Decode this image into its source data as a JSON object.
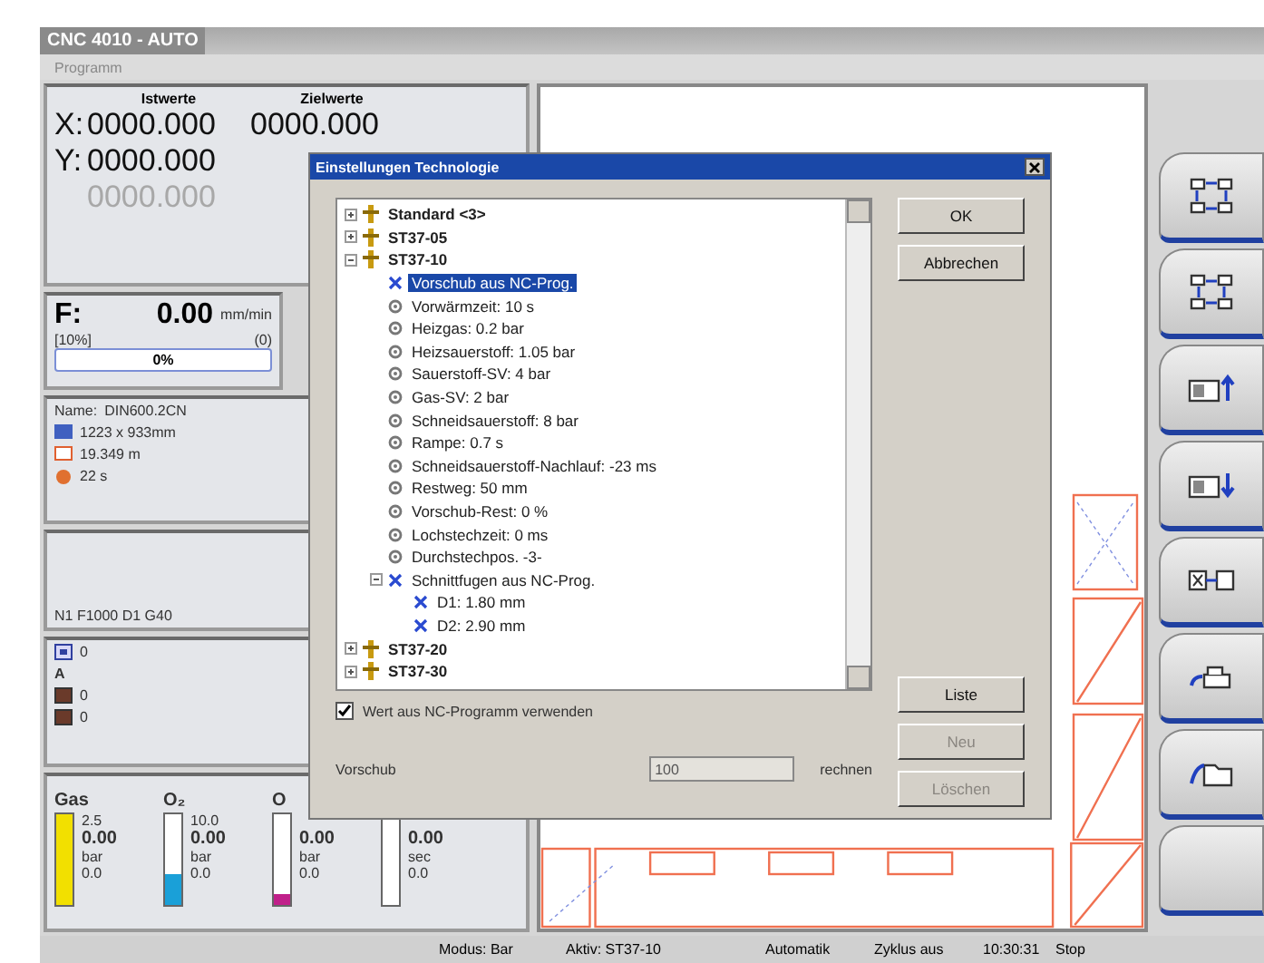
{
  "window": {
    "title": "CNC 4010 - AUTO"
  },
  "menu": [
    "Programm"
  ],
  "coordinates": {
    "headers": [
      "Istwerte",
      "Zielwerte"
    ],
    "rows": [
      {
        "axis": "X:",
        "actual": "0000.000",
        "target": "0000.000",
        "disabled": false
      },
      {
        "axis": "Y:",
        "actual": "0000.000",
        "disabled": false
      },
      {
        "actual": "0000.000",
        "disabled": true
      }
    ]
  },
  "feed": {
    "label": "F:",
    "value": "0.00",
    "unit": "mm/min",
    "override": "[10%]",
    "count": "(0)",
    "progress": "0%"
  },
  "job": {
    "name_label": "Name:",
    "name": "DIN600.2CN",
    "size": "1223 x 933mm",
    "length": "19.349 m",
    "time": "22 s"
  },
  "nc_line": "N1 F1000 D1 G40",
  "counters": [
    {
      "kind": "frame",
      "value": "0"
    },
    {
      "kind": "letter",
      "value": "A"
    },
    {
      "kind": "brown",
      "value": "0"
    },
    {
      "kind": "brown",
      "value": "0"
    }
  ],
  "gauges": [
    {
      "label": "Gas",
      "max": "2.5",
      "value": "0.00",
      "unit": "bar",
      "min": "0.0",
      "level": 1,
      "color": "#f2e000"
    },
    {
      "label": "O₂",
      "max": "10.0",
      "value": "0.00",
      "unit": "bar",
      "min": "0.0",
      "level": 0.35,
      "color": "#1aa0d8"
    },
    {
      "label": "O",
      "value": "0.00",
      "unit": "bar",
      "min": "0.0",
      "level": 0.12,
      "color": "#c0208a"
    },
    {
      "value": "0.00",
      "unit": "sec",
      "min": "0.0"
    }
  ],
  "dialog": {
    "title": "Einstellungen Technologie",
    "tree": [
      {
        "label": "Standard <3>",
        "kind": "material",
        "expanded": false,
        "selected": false
      },
      {
        "label": "ST37-05",
        "kind": "material",
        "expanded": false,
        "selected": false
      },
      {
        "label": "ST37-10",
        "kind": "material",
        "expanded": true,
        "selected": false,
        "children": [
          {
            "label": "Vorschub aus NC-Prog.",
            "kind": "nc",
            "selected": true
          },
          {
            "label": "Vorwärmzeit: 10 s",
            "kind": "param",
            "selected": false
          },
          {
            "label": "Heizgas: 0.2 bar",
            "kind": "param",
            "selected": false
          },
          {
            "label": "Heizsauerstoff: 1.05 bar",
            "kind": "param",
            "selected": false
          },
          {
            "label": "Sauerstoff-SV: 4 bar",
            "kind": "param",
            "selected": false
          },
          {
            "label": "Gas-SV: 2 bar",
            "kind": "param",
            "selected": false
          },
          {
            "label": "Schneidsauerstoff: 8 bar",
            "kind": "param",
            "selected": false
          },
          {
            "label": "Rampe: 0.7 s",
            "kind": "param",
            "selected": false
          },
          {
            "label": "Schneidsauerstoff-Nachlauf: -23 ms",
            "kind": "param",
            "selected": false
          },
          {
            "label": "Restweg: 50 mm",
            "kind": "param",
            "selected": false
          },
          {
            "label": "Vorschub-Rest: 0 %",
            "kind": "param",
            "selected": false
          },
          {
            "label": "Lochstechzeit: 0 ms",
            "kind": "param",
            "selected": false
          },
          {
            "label": "Durchstechpos. -3-",
            "kind": "param",
            "selected": false
          },
          {
            "label": "Schnittfugen aus NC-Prog.",
            "kind": "nc",
            "expanded": true,
            "selected": false,
            "children": [
              {
                "label": "D1: 1.80 mm",
                "kind": "nc",
                "selected": false
              },
              {
                "label": "D2: 2.90 mm",
                "kind": "nc",
                "selected": false
              }
            ]
          }
        ]
      },
      {
        "label": "ST37-20",
        "kind": "material",
        "expanded": false,
        "selected": false
      },
      {
        "label": "ST37-30",
        "kind": "material",
        "expanded": false,
        "selected": false
      }
    ],
    "buttons_top": [
      {
        "label": "OK",
        "disabled": false
      },
      {
        "label": "Abbrechen",
        "disabled": false
      }
    ],
    "buttons_bottom": [
      {
        "label": "Liste",
        "disabled": false
      },
      {
        "label": "Neu",
        "disabled": true
      },
      {
        "label": "Löschen",
        "disabled": true
      }
    ],
    "checkbox": {
      "label": "Wert aus NC-Programm verwenden",
      "checked": true
    },
    "feed_field": {
      "label": "Vorschub",
      "value": "100",
      "disabled": true,
      "action": "rechnen"
    }
  },
  "side_buttons": [
    {
      "kind": "expand"
    },
    {
      "kind": "shrink"
    },
    {
      "kind": "up"
    },
    {
      "kind": "down"
    },
    {
      "kind": "swap"
    },
    {
      "kind": "back"
    },
    {
      "kind": "folder"
    },
    {
      "kind": "empty"
    }
  ],
  "status_bar": [
    "Modus: Bar",
    "Aktiv: ST37-10",
    "Automatik",
    "Zyklus aus",
    "10:30:31",
    "Stop"
  ]
}
